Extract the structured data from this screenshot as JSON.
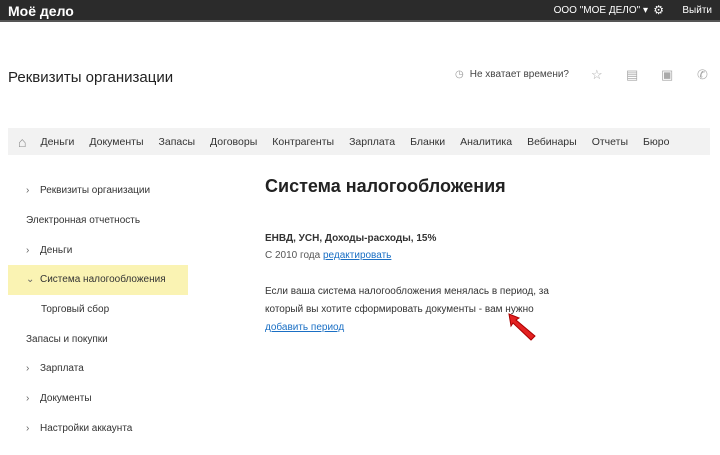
{
  "header": {
    "logo": "Моё дело",
    "org": "ООО \"МОЕ ДЕЛО\"",
    "logout": "Выйти"
  },
  "page": {
    "title": "Реквизиты организации",
    "help": "Не хватает времени?"
  },
  "nav": {
    "items": [
      "Деньги",
      "Документы",
      "Запасы",
      "Договоры",
      "Контрагенты",
      "Зарплата",
      "Бланки",
      "Аналитика",
      "Вебинары",
      "Отчеты",
      "Бюро"
    ]
  },
  "sidebar": {
    "items": [
      {
        "label": "Реквизиты организации",
        "chevron": "›"
      },
      {
        "label": "Электронная отчетность",
        "chevron": ""
      },
      {
        "label": "Деньги",
        "chevron": "›"
      },
      {
        "label": "Система налогообложения",
        "chevron": "⌄"
      },
      {
        "label": "Торговый сбор",
        "chevron": ""
      },
      {
        "label": "Запасы и покупки",
        "chevron": ""
      },
      {
        "label": "Зарплата",
        "chevron": "›"
      },
      {
        "label": "Документы",
        "chevron": "›"
      },
      {
        "label": "Настройки аккаунта",
        "chevron": "›"
      }
    ]
  },
  "main": {
    "heading": "Система налогообложения",
    "system": "ЕНВД, УСН, Доходы-расходы, 15%",
    "since": "С 2010 года",
    "edit_link": "редактировать",
    "note": "Если ваша система налогообложения менялась в период, за который вы хотите сформировать документы - вам нужно",
    "add_link": "добавить период"
  }
}
